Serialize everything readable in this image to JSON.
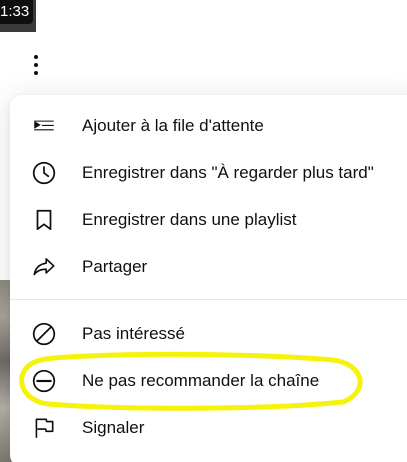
{
  "video": {
    "duration": "1:33"
  },
  "more_button": {
    "icon": "more-vert-icon"
  },
  "menu": {
    "items": [
      {
        "label": "Ajouter à la file d'attente",
        "icon": "add-to-queue-icon"
      },
      {
        "label": "Enregistrer dans \"À regarder plus tard\"",
        "icon": "clock-icon"
      },
      {
        "label": "Enregistrer dans une playlist",
        "icon": "bookmark-icon"
      },
      {
        "label": "Partager",
        "icon": "share-icon"
      },
      {
        "label": "Pas intéressé",
        "icon": "not-interested-icon"
      },
      {
        "label": "Ne pas recommander la chaîne",
        "icon": "remove-circle-icon"
      },
      {
        "label": "Signaler",
        "icon": "flag-icon"
      }
    ]
  },
  "annotation": {
    "color": "#f5f20c"
  }
}
